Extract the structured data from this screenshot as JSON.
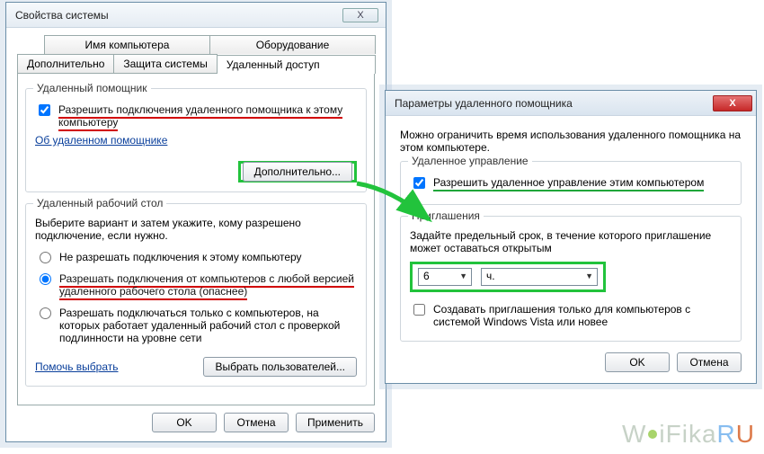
{
  "win1": {
    "title": "Свойства системы",
    "close_glyph": "X",
    "tabs_row1": [
      "Имя компьютера",
      "Оборудование"
    ],
    "tabs_row2": [
      "Дополнительно",
      "Защита системы",
      "Удаленный доступ"
    ],
    "assistant": {
      "groupTitle": "Удаленный помощник",
      "allowLabel": "Разрешить подключения удаленного помощника к этому компьютеру",
      "allowChecked": true,
      "aboutLink": "Об удаленном помощнике",
      "advancedBtn": "Дополнительно..."
    },
    "rdp": {
      "groupTitle": "Удаленный рабочий стол",
      "instruction": "Выберите вариант и затем укажите, кому разрешено подключение, если нужно.",
      "opt1": "Не разрешать подключения к этому компьютеру",
      "opt2": "Разрешать подключения от компьютеров с любой версией удаленного рабочего стола (опаснее)",
      "opt3": "Разрешать подключаться только с компьютеров, на которых работает удаленный рабочий стол с проверкой подлинности на уровне сети",
      "selected": 2,
      "helpLink": "Помочь выбрать",
      "selectUsersBtn": "Выбрать пользователей..."
    },
    "buttons": {
      "ok": "OK",
      "cancel": "Отмена",
      "apply": "Применить"
    }
  },
  "win2": {
    "title": "Параметры удаленного помощника",
    "close_glyph": "X",
    "intro": "Можно ограничить время использования удаленного помощника на этом компьютере.",
    "remoteControl": {
      "groupTitle": "Удаленное управление",
      "allowLabel": "Разрешить удаленное управление этим компьютером",
      "allowChecked": true
    },
    "invitations": {
      "groupTitle": "Приглашения",
      "instruction": "Задайте предельный срок, в течение которого приглашение может оставаться открытым",
      "valueOptions": [
        "6"
      ],
      "valueSelected": "6",
      "unitOptions": [
        "ч."
      ],
      "unitSelected": "ч.",
      "vistaLabel": "Создавать приглашения только для компьютеров с системой Windows Vista или новее",
      "vistaChecked": false
    },
    "buttons": {
      "ok": "OK",
      "cancel": "Отмена"
    }
  },
  "watermark": {
    "w": "W",
    "ifika": "iFika",
    "r": "R",
    "u": "U"
  }
}
